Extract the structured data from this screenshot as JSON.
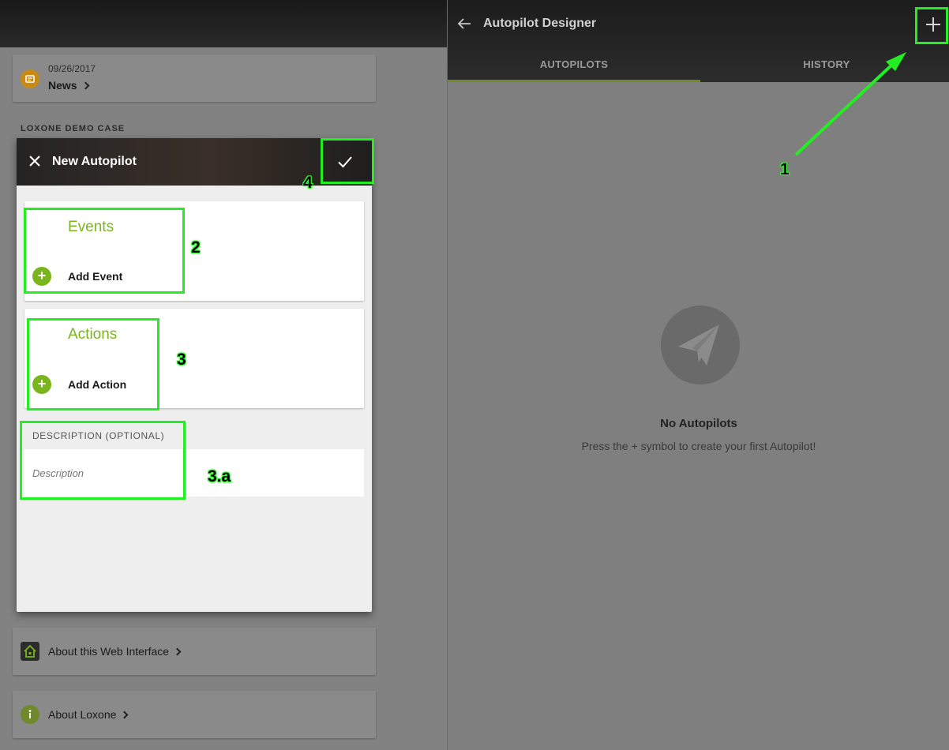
{
  "left": {
    "news": {
      "date": "09/26/2017",
      "label": "News",
      "icon": "newspaper-icon",
      "icon_color": "#c98a14"
    },
    "section_label": "LOXONE DEMO CASE",
    "about_web": {
      "label": "About this Web Interface",
      "icon": "home-logo-icon"
    },
    "about_loxone": {
      "label": "About Loxone",
      "icon": "info-icon",
      "icon_color": "#6e8a2a"
    }
  },
  "modal": {
    "title": "New Autopilot",
    "close_icon": "close-icon",
    "confirm_icon": "check-icon",
    "events": {
      "title": "Events",
      "add_label": "Add Event"
    },
    "actions": {
      "title": "Actions",
      "add_label": "Add Action"
    },
    "description": {
      "label": "DESCRIPTION (OPTIONAL)",
      "placeholder": "Description",
      "value": ""
    }
  },
  "right": {
    "title": "Autopilot Designer",
    "back_icon": "arrow-left-icon",
    "add_icon": "plus-icon",
    "tabs": [
      {
        "label": "AUTOPILOTS",
        "active": true
      },
      {
        "label": "HISTORY",
        "active": false
      }
    ],
    "empty": {
      "icon": "paper-plane-icon",
      "title": "No Autopilots",
      "subtitle": "Press the + symbol to create your first Autopilot!"
    }
  },
  "annotations": {
    "color": "#22ee22",
    "labels": [
      "1",
      "2",
      "3",
      "3.a",
      "4"
    ]
  },
  "colors": {
    "accent_green": "#7ab51d"
  }
}
